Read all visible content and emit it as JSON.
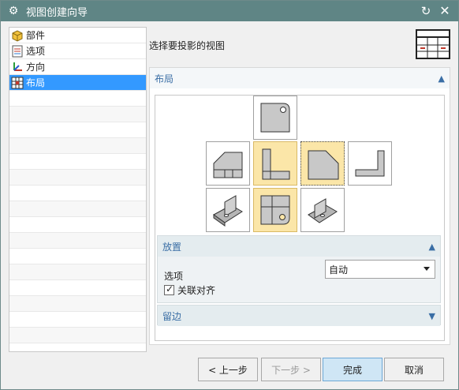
{
  "window": {
    "title": "视图创建向导"
  },
  "sidebar": {
    "items": [
      {
        "label": "部件",
        "icon": "cube-icon"
      },
      {
        "label": "选项",
        "icon": "checklist-icon"
      },
      {
        "label": "方向",
        "icon": "axes-icon"
      },
      {
        "label": "布局",
        "icon": "grid-layout-icon",
        "selected": true
      }
    ]
  },
  "header": {
    "label": "选择要投影的视图"
  },
  "layout_section": {
    "title": "布局"
  },
  "placement": {
    "title": "放置",
    "option_label": "选项",
    "option_value": "自动",
    "associative_align_label": "关联对齐",
    "associative_align_checked": true
  },
  "margin_section": {
    "title": "留边"
  },
  "buttons": {
    "back": "< 上一步",
    "next": "下一步 >",
    "finish": "完成",
    "cancel": "取消"
  },
  "colors": {
    "titlebar": "#5f8585",
    "selection": "#3399ff",
    "highlight": "#fbe6a8",
    "section_text": "#3a6ea5"
  }
}
